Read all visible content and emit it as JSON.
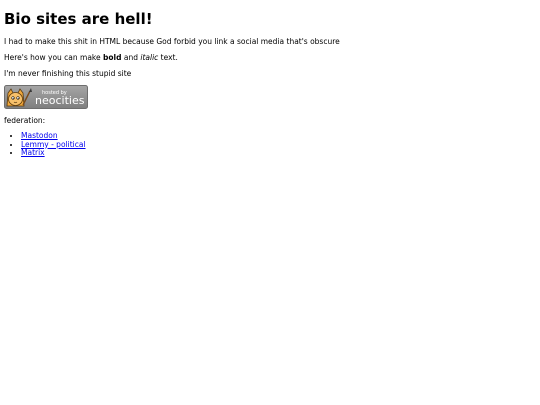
{
  "heading": "Bio sites are hell!",
  "paragraphs": {
    "p1": "I had to make this shit in HTML because God forbid you link a social media that's obscure",
    "p2_prefix": "Here's how you can make ",
    "p2_bold": "bold",
    "p2_middle": " and ",
    "p2_italic": "italic",
    "p2_suffix": " text.",
    "p3": "I'm never finishing this stupid site"
  },
  "badge": {
    "small_text": "hosted by",
    "brand_text": "neocities",
    "icon": "neocities-cat-icon"
  },
  "federation": {
    "label": "federation:",
    "links": [
      {
        "label": "Mastodon"
      },
      {
        "label": "Lemmy - political"
      },
      {
        "label": "Matrix"
      }
    ]
  },
  "colors": {
    "link": "#0000ee",
    "badge_bg": "#8c8c8c",
    "text": "#000000"
  }
}
